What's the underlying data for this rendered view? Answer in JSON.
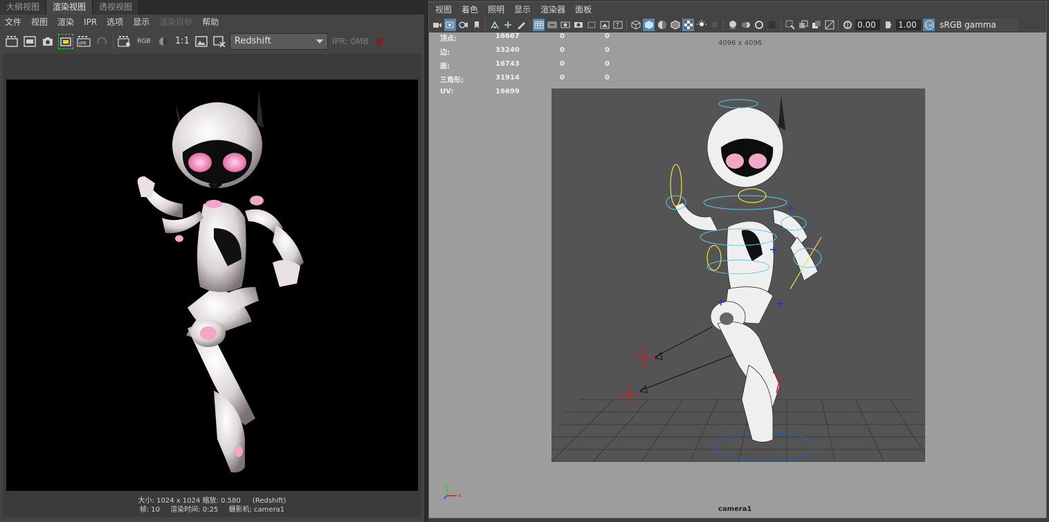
{
  "left_panel": {
    "tabs": [
      {
        "label": "大纲视图",
        "active": false
      },
      {
        "label": "渲染视图",
        "active": true
      },
      {
        "label": "透视视图",
        "active": false
      }
    ],
    "menu": [
      {
        "label": "文件",
        "enabled": true
      },
      {
        "label": "视图",
        "enabled": true
      },
      {
        "label": "渲染",
        "enabled": true
      },
      {
        "label": "IPR",
        "enabled": true
      },
      {
        "label": "选项",
        "enabled": true
      },
      {
        "label": "显示",
        "enabled": true
      },
      {
        "label": "渲染目标",
        "enabled": false
      },
      {
        "label": "帮助",
        "enabled": true
      }
    ],
    "toolbar": {
      "rgb_label": "RGB",
      "ratio_label": "1:1",
      "renderer": "Redshift",
      "ipr_status": "IPR: 0MB",
      "ipr_button_label": "IPR"
    },
    "render_info": {
      "line1_size": "大小: 1024 x 1024 缩放: 0.580",
      "line1_renderer": "(Redshift)",
      "frame": "帧: 10",
      "render_time": "渲染时间: 0:25",
      "camera": "摄影机: camera1"
    }
  },
  "right_panel": {
    "menu": [
      {
        "label": "视图"
      },
      {
        "label": "着色"
      },
      {
        "label": "照明"
      },
      {
        "label": "显示"
      },
      {
        "label": "渲染器"
      },
      {
        "label": "面板"
      }
    ],
    "toolbar": {
      "exposure": "0.00",
      "gamma": "1.00",
      "color_space": "sRGB gamma"
    },
    "hud": {
      "rows": [
        {
          "label": "顶点:",
          "value": "16667",
          "selected": "0",
          "component": "0"
        },
        {
          "label": "边:",
          "value": "33240",
          "selected": "0",
          "component": "0"
        },
        {
          "label": "面:",
          "value": "16743",
          "selected": "0",
          "component": "0"
        },
        {
          "label": "三角形:",
          "value": "31914",
          "selected": "0",
          "component": "0"
        },
        {
          "label": "UV:",
          "value": "16699",
          "selected": "0",
          "component": "0"
        }
      ],
      "resolution": "4096 x 4096",
      "camera_name": "camera1"
    },
    "axis": {
      "x": "x",
      "y": "y",
      "z": "z"
    }
  },
  "colors": {
    "panel_bg": "#444444",
    "viewport_bg": "#9d9d9d",
    "gate_bg": "#545454",
    "active_tool": "#5b86a8",
    "robot_eye": "#f2a6c8",
    "control_blue": "#5ec8f0",
    "control_yellow": "#f0e040",
    "ik_red": "#e01818"
  }
}
